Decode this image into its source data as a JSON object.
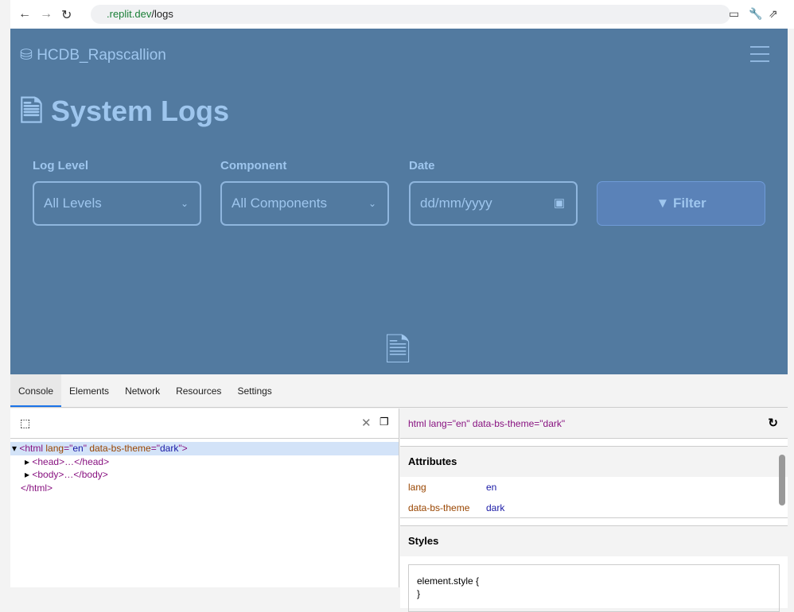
{
  "browser": {
    "url_domain": ".replit.dev",
    "url_path": "/logs"
  },
  "navbar": {
    "brand": "HCDB_Rapscallion"
  },
  "page": {
    "title": "System Logs",
    "filters": {
      "log_level_label": "Log Level",
      "log_level_value": "All Levels",
      "component_label": "Component",
      "component_value": "All Components",
      "date_label": "Date",
      "date_placeholder": "dd/mm/yyyy",
      "filter_button": "Filter"
    }
  },
  "devtools": {
    "tabs": [
      "Console",
      "Elements",
      "Network",
      "Resources",
      "Settings"
    ],
    "tree": {
      "html_open_tag": "html",
      "lang_attr": "lang",
      "lang_val": "en",
      "theme_attr": "data-bs-theme",
      "theme_val": "dark",
      "head": "<head>…</head>",
      "body": "<body>…</body>",
      "html_close": "</html>"
    },
    "selected": "html lang=\"en\" data-bs-theme=\"dark\"",
    "attributes_title": "Attributes",
    "attributes": [
      {
        "name": "lang",
        "value": "en"
      },
      {
        "name": "data-bs-theme",
        "value": "dark"
      }
    ],
    "styles_title": "Styles",
    "element_style": "element.style {",
    "close_brace": "}"
  }
}
